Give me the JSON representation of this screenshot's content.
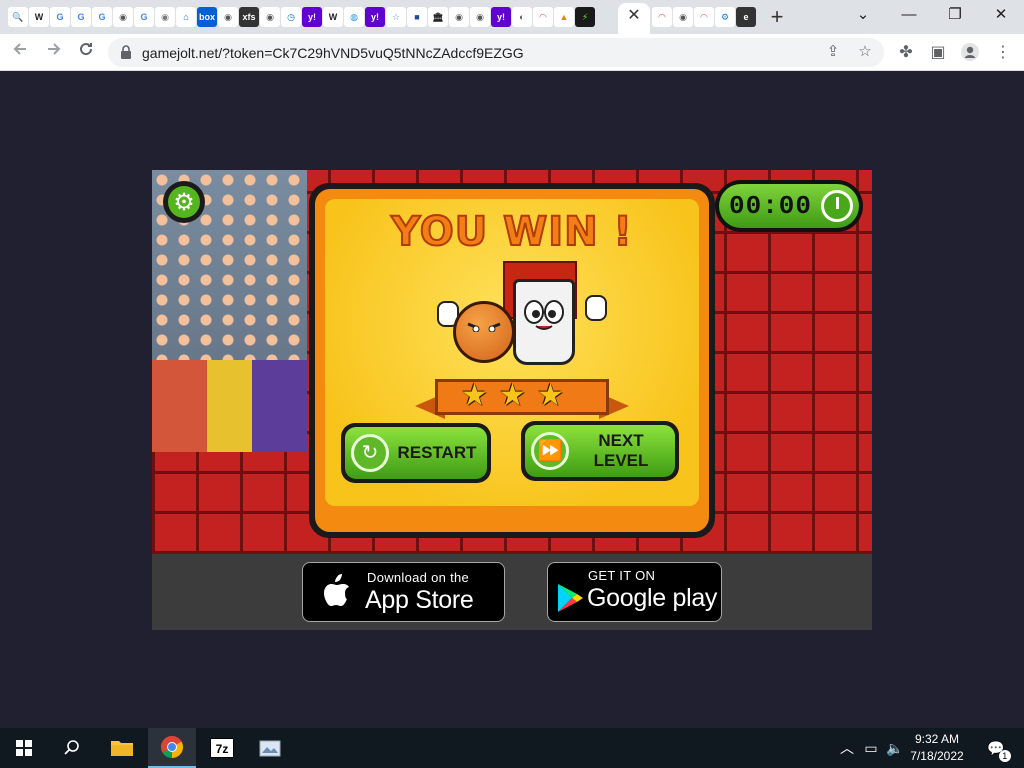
{
  "browser": {
    "tab_favicons": [
      {
        "name": "search-favicon",
        "glyph": "🔍",
        "bg": "#ffffff",
        "fg": "#1a73e8"
      },
      {
        "name": "wikipedia-favicon",
        "glyph": "W",
        "bg": "#ffffff",
        "fg": "#222222"
      },
      {
        "name": "google-favicon",
        "glyph": "G",
        "bg": "#ffffff",
        "fg": "#4285f4"
      },
      {
        "name": "google-favicon",
        "glyph": "G",
        "bg": "#ffffff",
        "fg": "#4285f4"
      },
      {
        "name": "google-favicon",
        "glyph": "G",
        "bg": "#ffffff",
        "fg": "#4285f4"
      },
      {
        "name": "globe-favicon",
        "glyph": "◉",
        "bg": "#ffffff",
        "fg": "#555555"
      },
      {
        "name": "google-favicon",
        "glyph": "G",
        "bg": "#ffffff",
        "fg": "#4285f4"
      },
      {
        "name": "globe-favicon",
        "glyph": "◉",
        "bg": "#ffffff",
        "fg": "#777777"
      },
      {
        "name": "home-favicon",
        "glyph": "⌂",
        "bg": "#ffffff",
        "fg": "#1a73e8"
      },
      {
        "name": "box-favicon",
        "glyph": "box",
        "bg": "#0061d5",
        "fg": "#ffffff"
      },
      {
        "name": "globe-favicon",
        "glyph": "◉",
        "bg": "#ffffff",
        "fg": "#555555"
      },
      {
        "name": "xfs-favicon",
        "glyph": "xfs",
        "bg": "#333333",
        "fg": "#ffffff"
      },
      {
        "name": "globe-favicon",
        "glyph": "◉",
        "bg": "#ffffff",
        "fg": "#555555"
      },
      {
        "name": "history-favicon",
        "glyph": "◷",
        "bg": "#ffffff",
        "fg": "#1a73e8"
      },
      {
        "name": "yahoo-favicon",
        "glyph": "y!",
        "bg": "#6001d2",
        "fg": "#ffffff"
      },
      {
        "name": "wikipedia-favicon",
        "glyph": "W",
        "bg": "#ffffff",
        "fg": "#222222"
      },
      {
        "name": "globe-favicon",
        "glyph": "◍",
        "bg": "#ffffff",
        "fg": "#1a9ad6"
      },
      {
        "name": "yahoo-favicon",
        "glyph": "y!",
        "bg": "#6001d2",
        "fg": "#ffffff"
      },
      {
        "name": "star-favicon",
        "glyph": "☆",
        "bg": "#ffffff",
        "fg": "#5f8dd3"
      },
      {
        "name": "square-favicon",
        "glyph": "■",
        "bg": "#ffffff",
        "fg": "#1f4e99"
      },
      {
        "name": "building-favicon",
        "glyph": "🏛",
        "bg": "#ffffff",
        "fg": "#222222"
      },
      {
        "name": "globe-favicon",
        "glyph": "◉",
        "bg": "#ffffff",
        "fg": "#555555"
      },
      {
        "name": "globe-favicon",
        "glyph": "◉",
        "bg": "#ffffff",
        "fg": "#555555"
      },
      {
        "name": "yahoo-favicon",
        "glyph": "y!",
        "bg": "#6001d2",
        "fg": "#ffffff"
      },
      {
        "name": "globe-favicon",
        "glyph": "◐",
        "bg": "#ffffff",
        "fg": "#555555"
      },
      {
        "name": "rainbow-favicon",
        "glyph": "◠",
        "bg": "#ffffff",
        "fg": "#e94b35"
      },
      {
        "name": "tent-favicon",
        "glyph": "▲",
        "bg": "#ffffff",
        "fg": "#e08a00"
      },
      {
        "name": "gamejolt-favicon",
        "glyph": "⚡",
        "bg": "#1a1a1a",
        "fg": "#6ceb2b"
      }
    ],
    "tab_favicons_after_active": [
      {
        "name": "rainbow-favicon",
        "glyph": "◠",
        "bg": "#ffffff",
        "fg": "#e94b35"
      },
      {
        "name": "globe-favicon",
        "glyph": "◉",
        "bg": "#ffffff",
        "fg": "#555555"
      },
      {
        "name": "rainbow-favicon",
        "glyph": "◠",
        "bg": "#ffffff",
        "fg": "#e94b35"
      },
      {
        "name": "gear-favicon",
        "glyph": "⚙",
        "bg": "#ffffff",
        "fg": "#1a73e8"
      },
      {
        "name": "e-favicon",
        "glyph": "e",
        "bg": "#333333",
        "fg": "#ffffff"
      }
    ],
    "close_tab_glyph": "✕",
    "new_tab_glyph": "+",
    "window_controls": {
      "menu": "⌄",
      "minimize": "—",
      "restore": "❐",
      "close": "✕"
    },
    "url": "gamejolt.net/?token=Ck7C29hVND5vuQ5tNNcZAdccf9EZGG"
  },
  "game": {
    "title": "YOU WIN !",
    "timer": "00:00",
    "stars_earned": 3,
    "stars_total": 3,
    "restart_label": "RESTART",
    "next_level_label": "NEXT\nLEVEL",
    "colors": {
      "brick": "#c42121",
      "panel_orange": "#f58a10",
      "panel_yellow": "#f8c41c",
      "button_green": "#5fb827"
    }
  },
  "stores": {
    "apple": {
      "small": "Download on the",
      "big": "App Store"
    },
    "google": {
      "small": "GET IT ON",
      "big": "Google play"
    }
  },
  "taskbar": {
    "time": "9:32 AM",
    "date": "7/18/2022",
    "notification_count": "1"
  }
}
